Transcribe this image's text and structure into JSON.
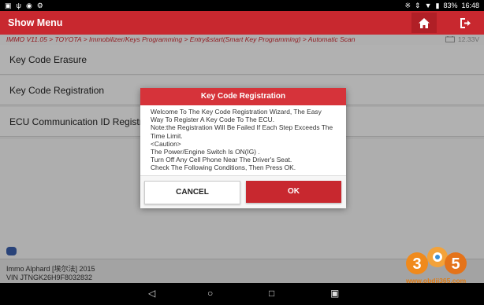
{
  "status_bar": {
    "battery": "83%",
    "time": "16:48"
  },
  "header": {
    "title": "Show Menu"
  },
  "breadcrumb": {
    "path": "IMMO V11.05 > TOYOTA > Immobilizer/Keys Programming > Entry&start(Smart Key Programming) > Automatic Scan",
    "voltage": "12.33V"
  },
  "menu": {
    "items": [
      {
        "label": "Key Code Erasure"
      },
      {
        "label": "Key Code Registration"
      },
      {
        "label": "ECU Communication ID Registration"
      }
    ]
  },
  "dialog": {
    "title": "Key Code Registration",
    "lines": [
      "Welcome To The Key Code Registration Wizard, The Easy",
      "Way To Register A Key Code To The ECU.",
      "Note:the Registration Will Be Failed If Each Step Exceeds The",
      "Time Limit.",
      "<Caution>",
      "The Power/Engine Switch Is ON(IG) .",
      "Turn Off Any Cell Phone Near The Driver's Seat.",
      "Check The Following Conditions, Then Press OK."
    ],
    "cancel_label": "CANCEL",
    "ok_label": "OK"
  },
  "footer": {
    "vehicle": "Immo Alphard [埃尔法] 2015",
    "vin": "VIN JTNGK26H9F8032832"
  },
  "watermark": {
    "logo_text": "365",
    "url": "www.obdii365.com"
  },
  "colors": {
    "brand_red": "#c8282f",
    "dialog_header": "#d6333a",
    "watermark_orange": "#e07a10"
  },
  "icons": {
    "home": "home-icon",
    "exit": "exit-icon",
    "back": "nav-back-icon",
    "home_nav": "nav-home-icon",
    "recents": "nav-recents-icon"
  }
}
